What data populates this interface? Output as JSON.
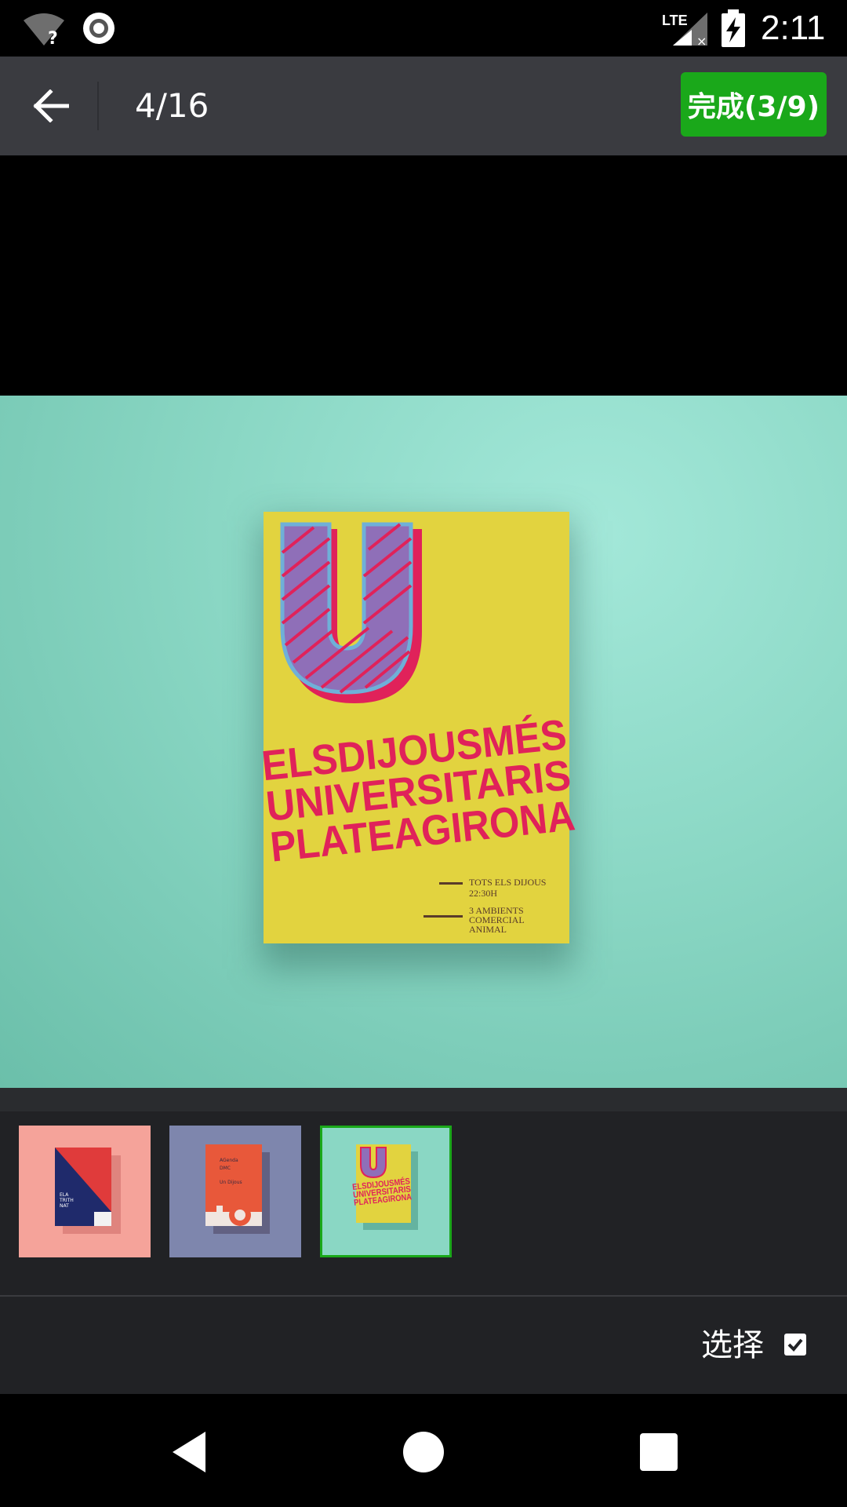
{
  "status_bar": {
    "time": "2:11",
    "network": "LTE",
    "icons": [
      "wifi-unknown-icon",
      "record-icon",
      "lte-signal-icon",
      "battery-charging-icon"
    ]
  },
  "toolbar": {
    "back_icon": "arrow-left-icon",
    "counter": "4/16",
    "done_label": "完成(3/9)",
    "accent_color": "#1aa81a"
  },
  "preview": {
    "book_title_lines": [
      "ELSDIJOUSMÉS",
      "UNIVERSITARIS",
      "PLATEAGIRONA"
    ],
    "book_big_letter": "U",
    "book_details": [
      "TOTS ELS DIJOUS",
      "22:30H",
      "3 AMBIENTS",
      "COMERCIAL",
      "ANIMAL"
    ],
    "background_color": "#8ad7c4",
    "book_color": "#e2d33f",
    "text_color": "#e0225a"
  },
  "thumbnails": [
    {
      "name": "thumbnail-1",
      "selected": false
    },
    {
      "name": "thumbnail-2",
      "selected": false
    },
    {
      "name": "thumbnail-3",
      "selected": true
    }
  ],
  "select_bar": {
    "label": "选择",
    "checked": true
  },
  "nav_bar": {
    "icons": [
      "nav-back-icon",
      "nav-home-icon",
      "nav-recents-icon"
    ]
  }
}
